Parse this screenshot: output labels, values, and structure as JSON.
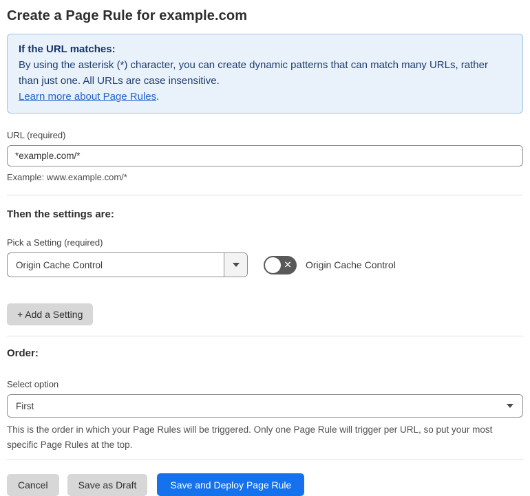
{
  "page_title": "Create a Page Rule for example.com",
  "info_box": {
    "heading": "If the URL matches:",
    "body": "By using the asterisk (*) character, you can create dynamic patterns that can match many URLs, rather than just one. All URLs are case insensitive.",
    "link_text": "Learn more about Page Rules",
    "link_suffix": "."
  },
  "url_section": {
    "label": "URL (required)",
    "input_value": "*example.com/*",
    "example": "Example: www.example.com/*"
  },
  "settings_section": {
    "heading": "Then the settings are:",
    "pick_label": "Pick a Setting (required)",
    "selected_setting": "Origin Cache Control",
    "toggle_state": "off",
    "toggle_off_icon": "✕",
    "toggle_label": "Origin Cache Control",
    "add_button_label": "+ Add a Setting"
  },
  "order_section": {
    "heading": "Order:",
    "label": "Select option",
    "selected_value": "First",
    "help_text": "This is the order in which your Page Rules will be triggered. Only one Page Rule will trigger per URL, so put your most specific Page Rules at the top."
  },
  "footer": {
    "cancel_label": "Cancel",
    "save_draft_label": "Save as Draft",
    "save_deploy_label": "Save and Deploy Page Rule"
  },
  "colors": {
    "primary_blue": "#1672ec",
    "info_background": "#e9f2fb",
    "info_border": "#9ec4e8",
    "info_text": "#1d3c6e",
    "link_blue": "#2462c9",
    "toggle_off_gray": "#595959",
    "button_gray": "#d7d7d7"
  }
}
